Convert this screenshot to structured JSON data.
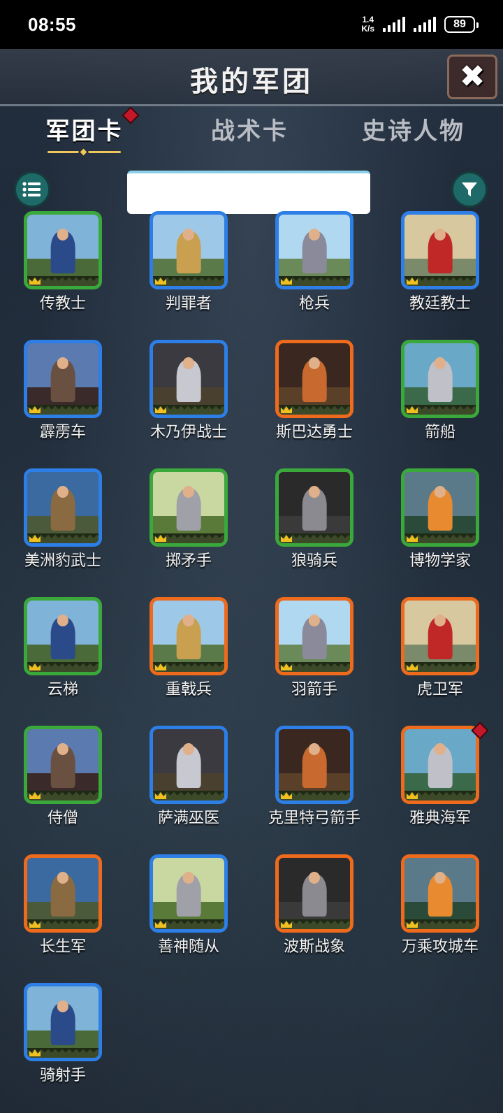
{
  "status_bar": {
    "time": "08:55",
    "net_speed_value": "1.4",
    "net_speed_unit": "K/s",
    "battery": "89"
  },
  "header": {
    "title": "我的军团"
  },
  "tabs": [
    {
      "label": "军团卡",
      "active": true,
      "badge": true
    },
    {
      "label": "战术卡",
      "active": false,
      "badge": false
    },
    {
      "label": "史诗人物",
      "active": false,
      "badge": false
    }
  ],
  "search": {
    "value": ""
  },
  "rarity_colors": {
    "green": "#3aa83a",
    "blue": "#2d7ee6",
    "orange": "#ee6a1c"
  },
  "cards": [
    {
      "name": "传教士",
      "rarity": "green",
      "badge": false
    },
    {
      "name": "判罪者",
      "rarity": "blue",
      "badge": false
    },
    {
      "name": "枪兵",
      "rarity": "blue",
      "badge": false
    },
    {
      "name": "教廷教士",
      "rarity": "blue",
      "badge": false
    },
    {
      "name": "霹雳车",
      "rarity": "blue",
      "badge": false
    },
    {
      "name": "木乃伊战士",
      "rarity": "blue",
      "badge": false
    },
    {
      "name": "斯巴达勇士",
      "rarity": "orange",
      "badge": false
    },
    {
      "name": "箭船",
      "rarity": "green",
      "badge": false
    },
    {
      "name": "美洲豹武士",
      "rarity": "blue",
      "badge": false
    },
    {
      "name": "掷矛手",
      "rarity": "green",
      "badge": false
    },
    {
      "name": "狼骑兵",
      "rarity": "green",
      "badge": false
    },
    {
      "name": "博物学家",
      "rarity": "green",
      "badge": false
    },
    {
      "name": "云梯",
      "rarity": "green",
      "badge": false
    },
    {
      "name": "重戟兵",
      "rarity": "orange",
      "badge": false
    },
    {
      "name": "羽箭手",
      "rarity": "orange",
      "badge": false
    },
    {
      "name": "虎卫军",
      "rarity": "orange",
      "badge": false
    },
    {
      "name": "侍僧",
      "rarity": "green",
      "badge": false
    },
    {
      "name": "萨满巫医",
      "rarity": "blue",
      "badge": false
    },
    {
      "name": "克里特弓箭手",
      "rarity": "blue",
      "badge": false
    },
    {
      "name": "雅典海军",
      "rarity": "orange",
      "badge": true
    },
    {
      "name": "长生军",
      "rarity": "orange",
      "badge": false
    },
    {
      "name": "善神随从",
      "rarity": "blue",
      "badge": false
    },
    {
      "name": "波斯战象",
      "rarity": "orange",
      "badge": false
    },
    {
      "name": "万乘攻城车",
      "rarity": "orange",
      "badge": false
    },
    {
      "name": "骑射手",
      "rarity": "blue",
      "badge": false
    }
  ]
}
